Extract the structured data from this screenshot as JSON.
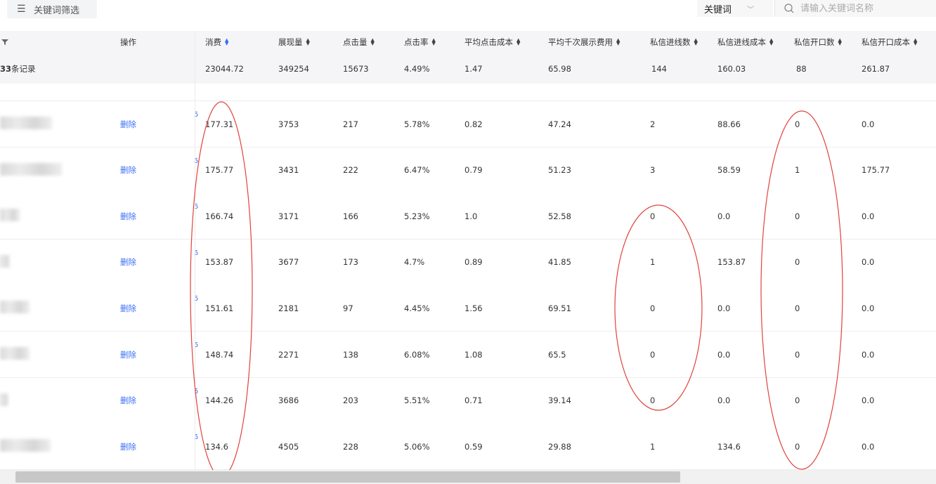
{
  "toolbar": {
    "filter_label": "关键词筛选",
    "keyword_select": "关键词",
    "search_placeholder": "请输入关键词名称"
  },
  "columns": {
    "op": "操作",
    "spend": "消费",
    "impressions": "展现量",
    "clicks": "点击量",
    "ctr": "点击率",
    "cpc": "平均点击成本",
    "cpm": "平均千次展示费用",
    "leads": "私信进线数",
    "lead_cost": "私信进线成本",
    "openings": "私信开口数",
    "opening_cost": "私信开口成本"
  },
  "summary": {
    "count": "33",
    "count_suffix": "条记录",
    "spend": "23044.72",
    "impressions": "349254",
    "clicks": "15673",
    "ctr": "4.49%",
    "cpc": "1.47",
    "cpm": "65.98",
    "leads": "144",
    "lead_cost": "160.03",
    "openings": "88",
    "opening_cost": "261.87"
  },
  "rows": [
    {
      "action": "删除",
      "mark": "5",
      "spend": "177.31",
      "impressions": "3753",
      "clicks": "217",
      "ctr": "5.78%",
      "cpc": "0.82",
      "cpm": "47.24",
      "leads": "2",
      "lead_cost": "88.66",
      "openings": "0",
      "opening_cost": "0.0"
    },
    {
      "action": "删除",
      "mark": "5",
      "spend": "175.77",
      "impressions": "3431",
      "clicks": "222",
      "ctr": "6.47%",
      "cpc": "0.79",
      "cpm": "51.23",
      "leads": "3",
      "lead_cost": "58.59",
      "openings": "1",
      "opening_cost": "175.77"
    },
    {
      "action": "删除",
      "mark": "5",
      "spend": "166.74",
      "impressions": "3171",
      "clicks": "166",
      "ctr": "5.23%",
      "cpc": "1.0",
      "cpm": "52.58",
      "leads": "0",
      "lead_cost": "0.0",
      "openings": "0",
      "opening_cost": "0.0"
    },
    {
      "action": "删除",
      "mark": "5",
      "spend": "153.87",
      "impressions": "3677",
      "clicks": "173",
      "ctr": "4.7%",
      "cpc": "0.89",
      "cpm": "41.85",
      "leads": "1",
      "lead_cost": "153.87",
      "openings": "0",
      "opening_cost": "0.0"
    },
    {
      "action": "删除",
      "mark": "5",
      "spend": "151.61",
      "impressions": "2181",
      "clicks": "97",
      "ctr": "4.45%",
      "cpc": "1.56",
      "cpm": "69.51",
      "leads": "0",
      "lead_cost": "0.0",
      "openings": "0",
      "opening_cost": "0.0"
    },
    {
      "action": "删除",
      "mark": "5",
      "spend": "148.74",
      "impressions": "2271",
      "clicks": "138",
      "ctr": "6.08%",
      "cpc": "1.08",
      "cpm": "65.5",
      "leads": "0",
      "lead_cost": "0.0",
      "openings": "0",
      "opening_cost": "0.0"
    },
    {
      "action": "删除",
      "mark": "5",
      "spend": "144.26",
      "impressions": "3686",
      "clicks": "203",
      "ctr": "5.51%",
      "cpc": "0.71",
      "cpm": "39.14",
      "leads": "0",
      "lead_cost": "0.0",
      "openings": "0",
      "opening_cost": "0.0"
    },
    {
      "action": "删除",
      "mark": "5",
      "spend": "134.6",
      "impressions": "4505",
      "clicks": "228",
      "ctr": "5.06%",
      "cpc": "0.59",
      "cpm": "29.88",
      "leads": "1",
      "lead_cost": "134.6",
      "openings": "0",
      "opening_cost": "0.0"
    }
  ],
  "colors": {
    "link": "#3b6ff5",
    "annotation": "#e0433b",
    "header_bg": "#f5f5f7"
  }
}
